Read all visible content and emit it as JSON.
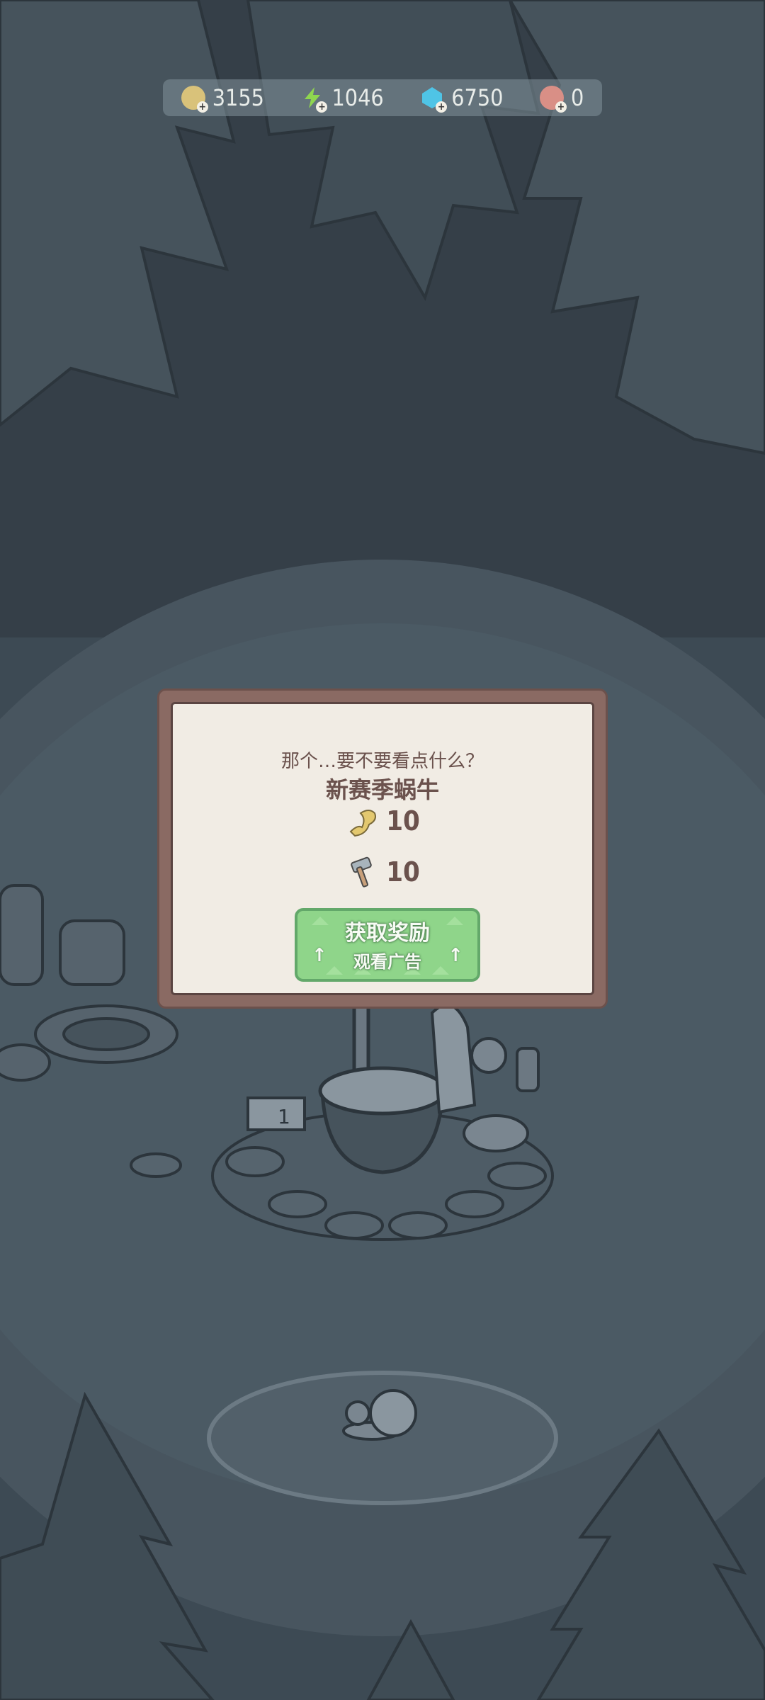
{
  "resources": [
    {
      "icon": "coin-icon",
      "value": "3155"
    },
    {
      "icon": "lightning-icon",
      "value": "1046"
    },
    {
      "icon": "gem-icon",
      "value": "6750"
    },
    {
      "icon": "shell-icon",
      "value": "0"
    }
  ],
  "dialog": {
    "question": "那个…要不要看点什么？",
    "title": "新赛季蜗牛",
    "rewards": [
      {
        "icon": "fungus-icon",
        "amount": "10"
      },
      {
        "icon": "hammer-icon",
        "amount": "10"
      }
    ],
    "button_label": "获取奖励",
    "button_sublabel": "观看广告"
  },
  "scene": {
    "sign_number": "1"
  }
}
